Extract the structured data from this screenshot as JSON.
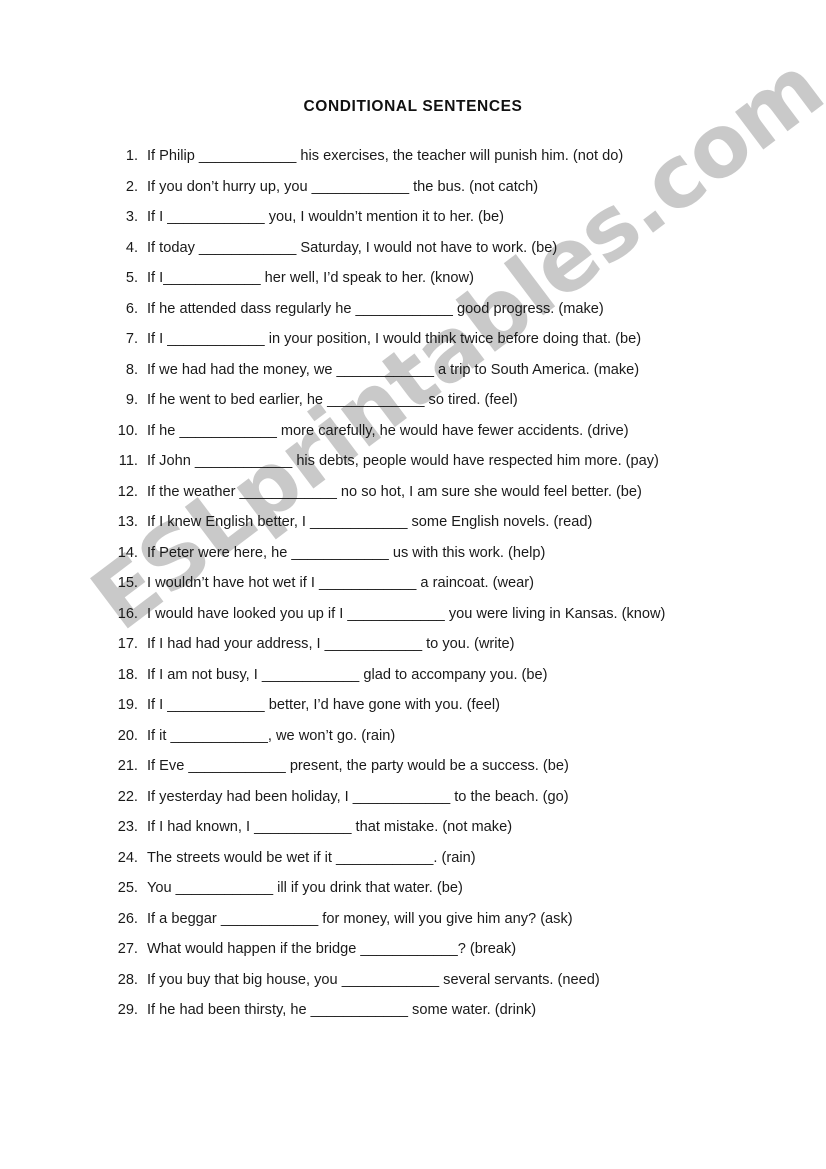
{
  "document": {
    "title": "CONDITIONAL SENTENCES",
    "watermark": "ESLprintables.com",
    "watermark_color": "#c9c9c9",
    "text_color": "#1a1a1a",
    "background_color": "#ffffff"
  },
  "exercises": [
    {
      "number": "1.",
      "text": "If Philip ____________ his exercises, the teacher will punish him. (not do)"
    },
    {
      "number": "2.",
      "text": "If you don’t hurry up, you ____________ the bus. (not catch)"
    },
    {
      "number": "3.",
      "text": "If I ____________ you, I wouldn’t mention it to her. (be)"
    },
    {
      "number": "4.",
      "text": "If today ____________ Saturday, I would not have to work. (be)"
    },
    {
      "number": "5.",
      "text": "If I____________ her well, I’d speak to her. (know)"
    },
    {
      "number": "6.",
      "text": "If he attended dass regularly he ____________ good progress. (make)"
    },
    {
      "number": "7.",
      "text": "If I ____________ in your position, I would think twice before doing that. (be)"
    },
    {
      "number": "8.",
      "text": "If we had had the money, we ____________  a trip to South America. (make)"
    },
    {
      "number": "9.",
      "text": "If he went to bed earlier, he ____________ so tired. (feel)"
    },
    {
      "number": "10.",
      "text": "If he ____________ more carefully, he would have fewer accidents. (drive)"
    },
    {
      "number": "11.",
      "text": "If John ____________ his debts, people would have respected him more. (pay)"
    },
    {
      "number": "12.",
      "text": "If the weather ____________ no so hot, I am sure she would feel better. (be)"
    },
    {
      "number": "13.",
      "text": "If I knew English better, I ____________ some English novels. (read)"
    },
    {
      "number": "14.",
      "text": "If Peter were here, he ____________ us with this work.  (help)"
    },
    {
      "number": "15.",
      "text": "I wouldn’t have hot wet if I ____________ a raincoat. (wear)"
    },
    {
      "number": "16.",
      "text": "I would have looked you up if I ____________ you were living in Kansas. (know)"
    },
    {
      "number": "17.",
      "text": "If I had had your address, I ____________ to you. (write)"
    },
    {
      "number": "18.",
      "text": "If I am not busy, I ____________ glad to accompany you. (be)"
    },
    {
      "number": "19.",
      "text": "If I ____________ better, I’d have gone with you. (feel)"
    },
    {
      "number": "20.",
      "text": "If it ____________, we won’t go. (rain)"
    },
    {
      "number": "21.",
      "text": "If Eve ____________ present, the party would be a success. (be)"
    },
    {
      "number": "22.",
      "text": "If yesterday had been holiday, I ____________ to the beach. (go)"
    },
    {
      "number": "23.",
      "text": "If I had known, I ____________ that mistake. (not make)"
    },
    {
      "number": "24.",
      "text": "The streets would be wet if it ____________. (rain)"
    },
    {
      "number": "25.",
      "text": "You ____________ ill if you drink that water. (be)"
    },
    {
      "number": "26.",
      "text": "If a beggar ____________ for money, will you give him any? (ask)"
    },
    {
      "number": "27.",
      "text": "What would happen if the bridge ____________? (break)"
    },
    {
      "number": "28.",
      "text": "If you buy that big house, you ____________ several servants. (need)"
    },
    {
      "number": "29.",
      "text": "If he had been thirsty, he ____________ some water. (drink)"
    }
  ]
}
